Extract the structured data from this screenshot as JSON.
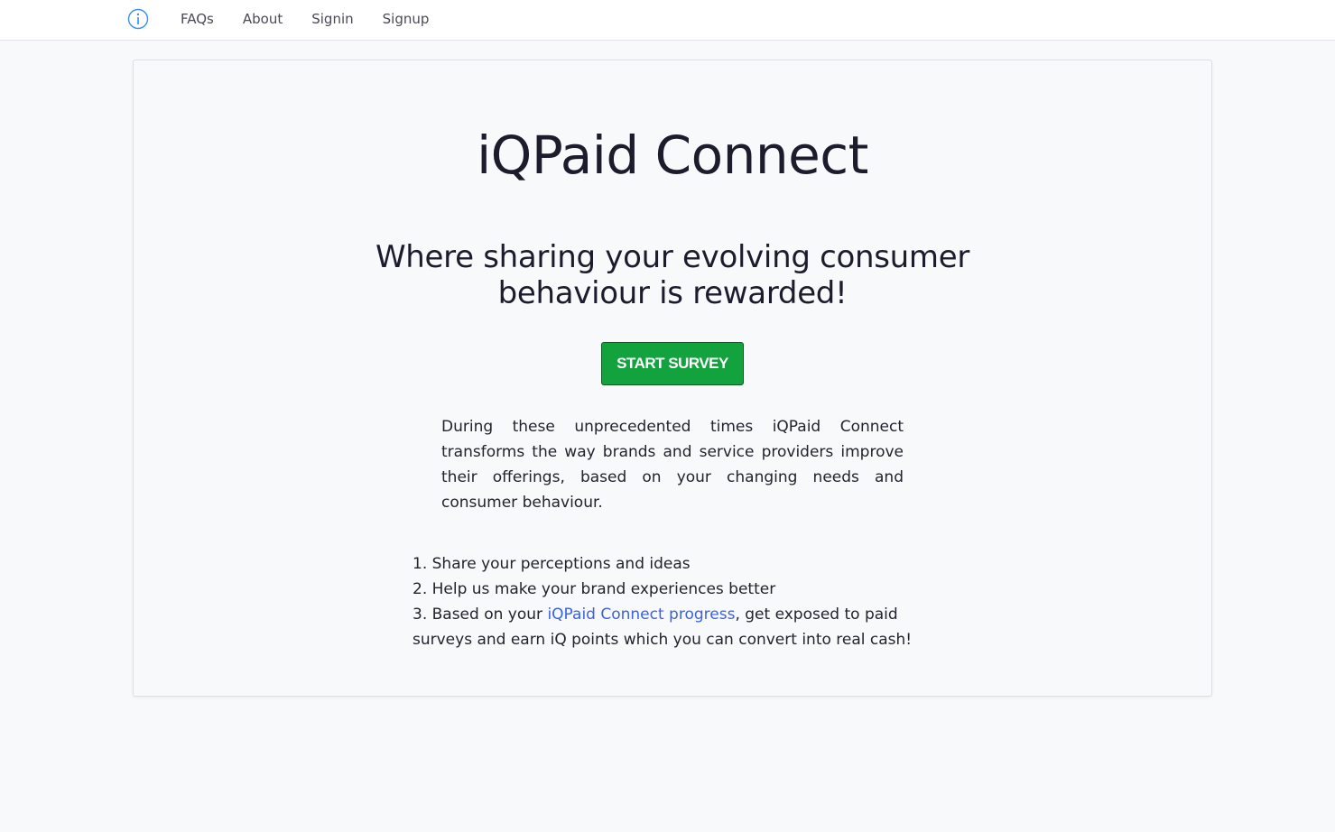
{
  "nav": {
    "info_icon": "info-circle-icon",
    "links": [
      "FAQs",
      "About",
      "Signin",
      "Signup"
    ]
  },
  "hero": {
    "title": "iQPaid Connect",
    "tagline": "Where sharing your evolving consumer behaviour is rewarded!",
    "cta_label": "START SURVEY",
    "description": "During these unprecedented times iQPaid Connect transforms the way brands and service providers improve their offerings, based on your changing needs and consumer behaviour."
  },
  "benefits": {
    "item1": "1.  Share your perceptions and ideas",
    "item2": "2. Help us make your brand experiences better",
    "item3_prefix": "3. Based on your ",
    "item3_link": "iQPaid Connect progress",
    "item3_suffix": ", get exposed to paid surveys and earn iQ points which you can convert into real cash!"
  },
  "colors": {
    "accent_green": "#12a33e",
    "link_blue": "#3b62e0",
    "icon_blue": "#3a8ee6",
    "background": "#f8f9fb"
  }
}
